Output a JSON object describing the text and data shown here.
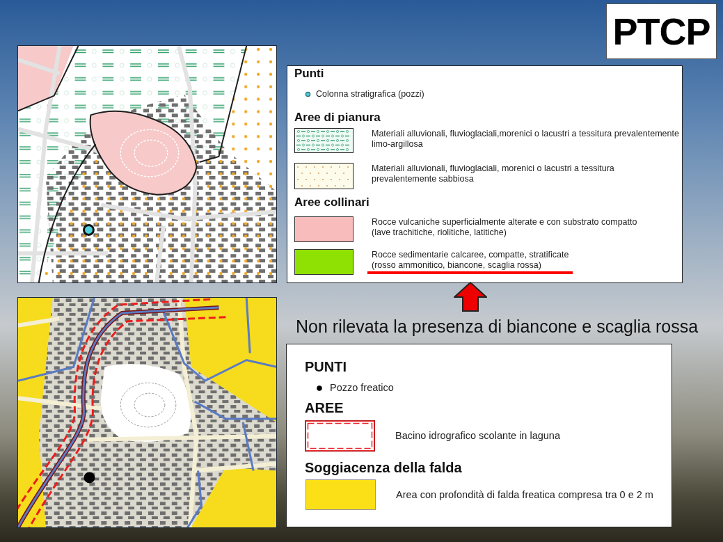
{
  "logo": {
    "text": "PTCP"
  },
  "geology_legend": {
    "sections": [
      {
        "title": "Punti",
        "items": [
          {
            "kind": "point",
            "color": "#4fc9cf",
            "label": "Colonna stratigrafica (pozzi)",
            "underlined": false
          }
        ]
      },
      {
        "title": "Aree di pianura",
        "items": [
          {
            "kind": "dashes",
            "label": "Materiali alluvionali, fluvioglaciali,morenici o lacustri a tessitura prevalentemente\nlimo-argillosa",
            "underlined": false
          },
          {
            "kind": "dots",
            "label": "Materiali alluvionali, fluvioglaciali, morenici o lacustri a tessitura\nprevalentemente sabbiosa",
            "underlined": false
          }
        ]
      },
      {
        "title": "Aree collinari",
        "items": [
          {
            "kind": "fill",
            "color": "#f9bcbd",
            "label": "Rocce vulcaniche superficialmente alterate e con substrato compatto\n(lave trachitiche, riolitiche, latitiche)",
            "underlined": false
          },
          {
            "kind": "fill",
            "color": "#8fe003",
            "label": "Rocce sedimentarie calcaree, compatte, stratificate\n(rosso ammonitico, biancone, scaglia rossa)",
            "underlined": true
          }
        ]
      }
    ]
  },
  "note": {
    "text": "Non rilevata la presenza di biancone e scaglia rossa"
  },
  "groundwater_legend": {
    "sections": [
      {
        "title": "PUNTI",
        "items": [
          {
            "kind": "point",
            "color": "#000000",
            "label": "Pozzo freatico"
          }
        ]
      },
      {
        "title": "AREE",
        "items": [
          {
            "kind": "boundary",
            "color": "#e8262a",
            "label": "Bacino idrografico scolante in laguna"
          }
        ]
      },
      {
        "title": "Soggiacenza della falda",
        "items": [
          {
            "kind": "fill",
            "color": "#fbe017",
            "label": "Area con profondità di falda freatica compresa tra 0 e 2 m"
          }
        ]
      }
    ]
  }
}
